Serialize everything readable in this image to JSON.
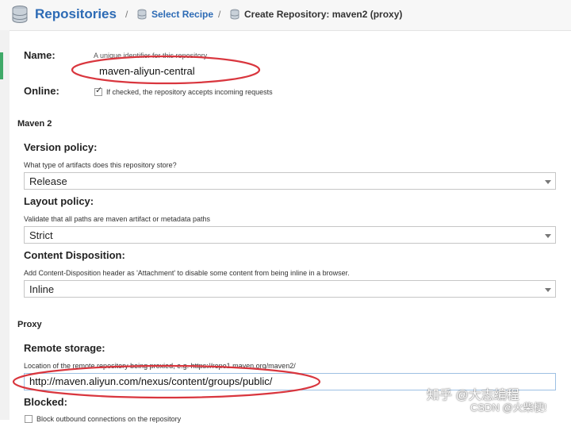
{
  "header": {
    "title": "Repositories",
    "crumb_link": "Select Recipe",
    "crumb_current": "Create Repository: maven2 (proxy)",
    "separator": "/"
  },
  "form": {
    "name": {
      "label": "Name:",
      "help": "A unique identifier for this repository",
      "value": "maven-aliyun-central"
    },
    "online": {
      "label": "Online:",
      "checked": true,
      "help": "If checked, the repository accepts incoming requests"
    },
    "maven_section": "Maven 2",
    "version_policy": {
      "label": "Version policy:",
      "help": "What type of artifacts does this repository store?",
      "value": "Release"
    },
    "layout_policy": {
      "label": "Layout policy:",
      "help": "Validate that all paths are maven artifact or metadata paths",
      "value": "Strict"
    },
    "content_disposition": {
      "label": "Content Disposition:",
      "help": "Add Content-Disposition header as 'Attachment' to disable some content from being inline in a browser.",
      "value": "Inline"
    },
    "proxy_section": "Proxy",
    "remote_storage": {
      "label": "Remote storage:",
      "help": "Location of the remote repository being proxied, e.g. https://repo1.maven.org/maven2/",
      "value": "http://maven.aliyun.com/nexus/content/groups/public/"
    },
    "blocked": {
      "label": "Blocked:",
      "help": "Block outbound connections on the repository"
    }
  },
  "watermark": {
    "zhihu": "知乎 @大志编程",
    "csdn": "CSDN @火柴梗!"
  },
  "colors": {
    "brand_blue": "#2d6bb5",
    "annotation_red": "#d9363e",
    "accent_green": "#3fa968"
  }
}
